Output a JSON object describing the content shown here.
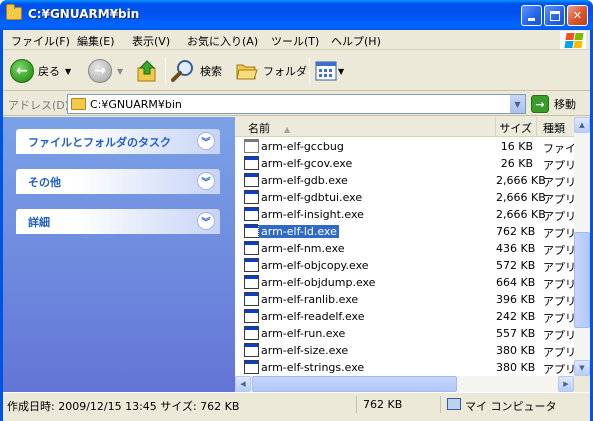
{
  "window": {
    "title": "C:¥GNUARM¥bin"
  },
  "menu": [
    "ファイル(F)",
    "編集(E)",
    "表示(V)",
    "お気に入り(A)",
    "ツール(T)",
    "ヘルプ(H)"
  ],
  "toolbar": {
    "back": "戻る",
    "search": "検索",
    "folders": "フォルダ"
  },
  "address": {
    "label": "アドレス(D)",
    "value": "C:¥GNUARM¥bin",
    "go": "移動"
  },
  "tasks": [
    {
      "title": "ファイルとフォルダのタスク"
    },
    {
      "title": "その他"
    },
    {
      "title": "詳細"
    }
  ],
  "columns": {
    "name": "名前",
    "size": "サイズ",
    "type": "種類"
  },
  "files": [
    {
      "name": "arm-elf-gccbug",
      "size": "16 KB",
      "type": "ファイル",
      "icon": "text-file-icon"
    },
    {
      "name": "arm-elf-gcov.exe",
      "size": "26 KB",
      "type": "アプリケ",
      "icon": "exe-file-icon"
    },
    {
      "name": "arm-elf-gdb.exe",
      "size": "2,666 KB",
      "type": "アプリケ",
      "icon": "exe-file-icon"
    },
    {
      "name": "arm-elf-gdbtui.exe",
      "size": "2,666 KB",
      "type": "アプリケ",
      "icon": "exe-file-icon"
    },
    {
      "name": "arm-elf-insight.exe",
      "size": "2,666 KB",
      "type": "アプリケ",
      "icon": "exe-file-icon"
    },
    {
      "name": "arm-elf-ld.exe",
      "size": "762 KB",
      "type": "アプリケ",
      "icon": "exe-file-icon",
      "selected": true
    },
    {
      "name": "arm-elf-nm.exe",
      "size": "436 KB",
      "type": "アプリケ",
      "icon": "exe-file-icon"
    },
    {
      "name": "arm-elf-objcopy.exe",
      "size": "572 KB",
      "type": "アプリケ",
      "icon": "exe-file-icon"
    },
    {
      "name": "arm-elf-objdump.exe",
      "size": "664 KB",
      "type": "アプリケ",
      "icon": "exe-file-icon"
    },
    {
      "name": "arm-elf-ranlib.exe",
      "size": "396 KB",
      "type": "アプリケ",
      "icon": "exe-file-icon"
    },
    {
      "name": "arm-elf-readelf.exe",
      "size": "242 KB",
      "type": "アプリケ",
      "icon": "exe-file-icon"
    },
    {
      "name": "arm-elf-run.exe",
      "size": "557 KB",
      "type": "アプリケ",
      "icon": "exe-file-icon"
    },
    {
      "name": "arm-elf-size.exe",
      "size": "380 KB",
      "type": "アプリケ",
      "icon": "exe-file-icon"
    },
    {
      "name": "arm-elf-strings.exe",
      "size": "380 KB",
      "type": "アプリケ",
      "icon": "exe-file-icon"
    }
  ],
  "status": {
    "info": "作成日時: 2009/12/15 13:45 サイズ: 762 KB",
    "size": "762 KB",
    "zone": "マイ コンピュータ"
  },
  "colors": {
    "title_bar": "#0054e3",
    "task_pane": "#6f8fe0",
    "selection": "#316ac5"
  }
}
